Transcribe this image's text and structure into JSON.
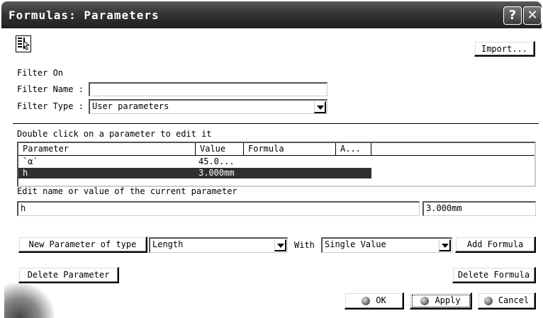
{
  "window": {
    "title": "Formulas: Parameters",
    "help_glyph": "?",
    "close_glyph": "✕"
  },
  "toolbar": {
    "import_label": "Import..."
  },
  "filter": {
    "section_label": "Filter On",
    "name_label": "Filter Name :",
    "name_value": "",
    "type_label": "Filter Type :",
    "type_value": "User parameters"
  },
  "parameters": {
    "instruction": "Double click on a parameter to edit it",
    "columns": [
      "Parameter",
      "Value",
      "Formula",
      "A..."
    ],
    "rows": [
      {
        "parameter": "`α`",
        "value": "45.0...",
        "formula": "",
        "active": "",
        "selected": false
      },
      {
        "parameter": "h",
        "value": "3.000mm",
        "formula": "",
        "active": "",
        "selected": true
      }
    ]
  },
  "edit": {
    "label": "Edit name or value of the current parameter",
    "name_value": "h",
    "value_value": "3.000mm"
  },
  "new_param": {
    "button_label": "New Parameter of type",
    "type_value": "Length",
    "with_label": "With",
    "with_value": "Single Value",
    "add_formula_label": "Add Formula"
  },
  "actions": {
    "delete_parameter_label": "Delete Parameter",
    "delete_formula_label": "Delete Formula",
    "ok_label": "OK",
    "apply_label": "Apply",
    "cancel_label": "Cancel"
  }
}
